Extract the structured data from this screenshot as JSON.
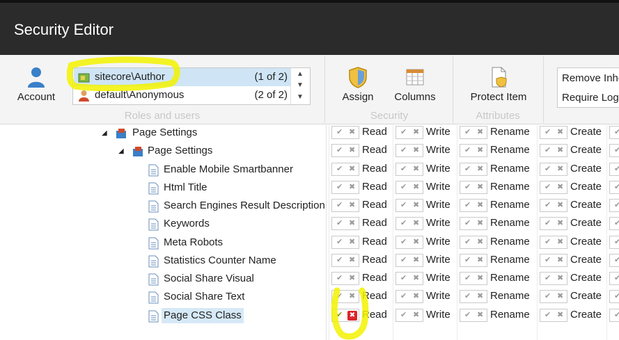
{
  "window": {
    "title": "Security Editor"
  },
  "ribbon": {
    "account_label": "Account",
    "roles": [
      {
        "name": "sitecore\\Author",
        "count": "(1 of 2)",
        "selected": true
      },
      {
        "name": "default\\Anonymous",
        "count": "(2 of 2)",
        "selected": false
      }
    ],
    "roles_group_label": "Roles and users",
    "assign_label": "Assign",
    "columns_label": "Columns",
    "security_group_label": "Security",
    "protect_label": "Protect Item",
    "attributes_group_label": "Attributes",
    "remove_inheritance_label": "Remove Inhe",
    "require_login_label": "Require Logi"
  },
  "tree": {
    "items": [
      {
        "label": "Page Settings",
        "level": 0,
        "expanded": true,
        "type": "folder"
      },
      {
        "label": "Page Settings",
        "level": 1,
        "expanded": true,
        "type": "folder"
      },
      {
        "label": "Enable Mobile Smartbanner",
        "level": 2,
        "type": "doc"
      },
      {
        "label": "Html Title",
        "level": 2,
        "type": "doc"
      },
      {
        "label": "Search Engines Result Description",
        "level": 2,
        "type": "doc"
      },
      {
        "label": "Keywords",
        "level": 2,
        "type": "doc"
      },
      {
        "label": "Meta Robots",
        "level": 2,
        "type": "doc"
      },
      {
        "label": "Statistics Counter Name",
        "level": 2,
        "type": "doc"
      },
      {
        "label": "Social Share Visual",
        "level": 2,
        "type": "doc"
      },
      {
        "label": "Social Share Text",
        "level": 2,
        "type": "doc"
      },
      {
        "label": "Page CSS Class",
        "level": 2,
        "type": "doc",
        "selected": true
      }
    ]
  },
  "rights": {
    "columns": [
      "Read",
      "Write",
      "Rename",
      "Create"
    ],
    "denied_row": 10
  },
  "colors": {
    "titlebar": "#2b2b2b",
    "selection": "#cfe5f6",
    "highlight": "#f2f200",
    "deny": "#d9262c"
  }
}
